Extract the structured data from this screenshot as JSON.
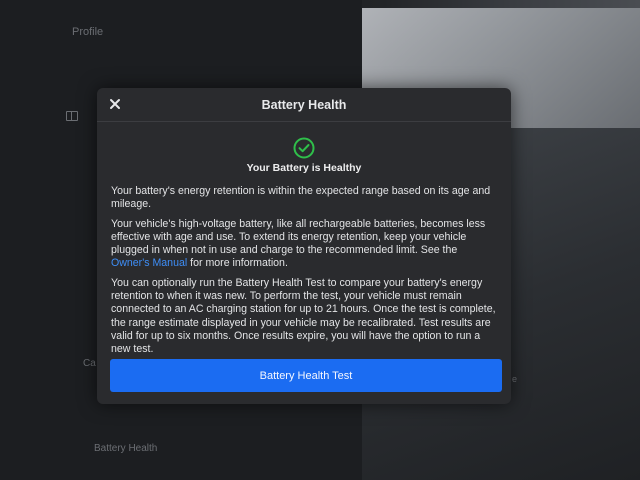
{
  "background": {
    "profile_label": "Profile",
    "left_partial_label": "Ca",
    "bottom_label": "Battery Health",
    "right_partial_label": "e"
  },
  "modal": {
    "title": "Battery Health",
    "close_icon": "close-icon",
    "status_icon": "check-circle-icon",
    "status_text": "Your Battery is Healthy",
    "paragraphs": {
      "p1": "Your battery's energy retention is within the expected range based on its age and mileage.",
      "p2_before_link": "Your vehicle's high-voltage battery, like all rechargeable batteries, becomes less effective with age and use. To extend its energy retention, keep your vehicle plugged in when not in use and charge to the recommended limit. See the ",
      "p2_link": "Owner's Manual",
      "p2_after_link": " for more information.",
      "p3": "You can optionally run the Battery Health Test to compare your battery's energy retention to when it was new. To perform the test, your vehicle must remain connected to an AC charging station for up to 21 hours. Once the test is complete, the range estimate displayed in your vehicle may be recalibrated. Test results are valid for up to six months. Once results expire, you will have the option to run a new test."
    },
    "button_label": "Battery Health Test"
  },
  "colors": {
    "accent_blue": "#1b6cf2",
    "link_blue": "#3e8ef7",
    "success_green": "#2fbf4a",
    "modal_bg": "#2a2b2e"
  }
}
